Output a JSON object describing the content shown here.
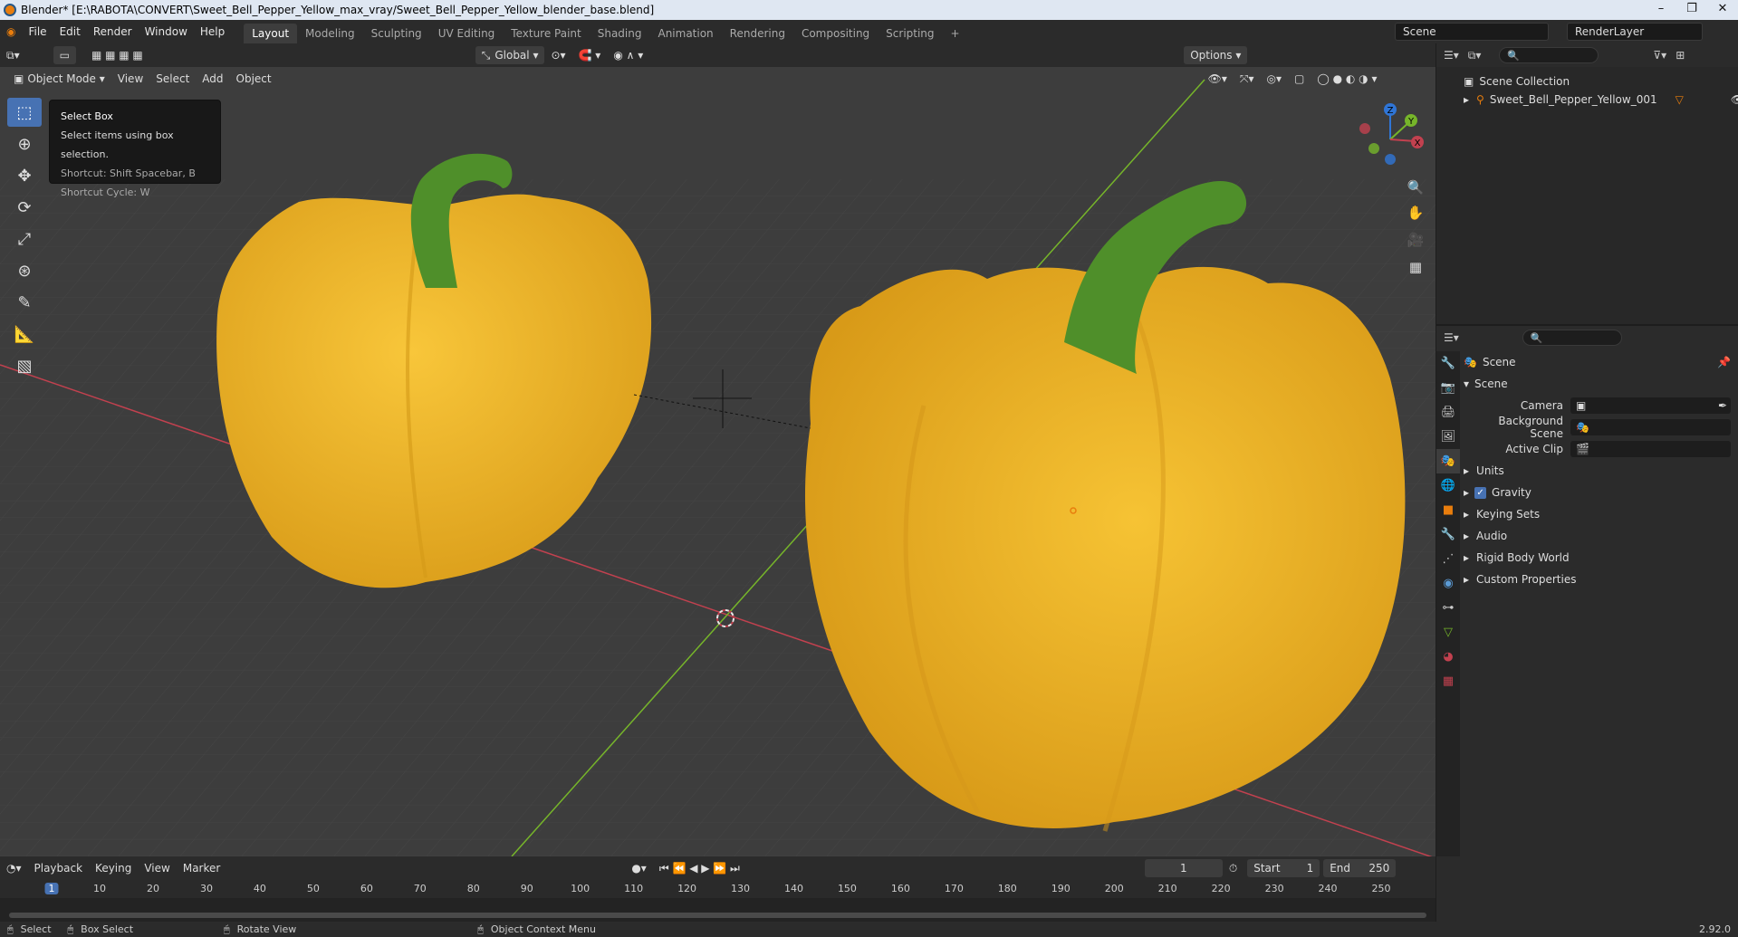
{
  "window": {
    "title": "Blender* [E:\\RABOTA\\CONVERT\\Sweet_Bell_Pepper_Yellow_max_vray/Sweet_Bell_Pepper_Yellow_blender_base.blend]",
    "controls": [
      "–",
      "❐",
      "✕"
    ]
  },
  "menu": [
    "File",
    "Edit",
    "Render",
    "Window",
    "Help"
  ],
  "workspaces": [
    {
      "label": "Layout",
      "active": true
    },
    {
      "label": "Modeling"
    },
    {
      "label": "Sculpting"
    },
    {
      "label": "UV Editing"
    },
    {
      "label": "Texture Paint"
    },
    {
      "label": "Shading"
    },
    {
      "label": "Animation"
    },
    {
      "label": "Rendering"
    },
    {
      "label": "Compositing"
    },
    {
      "label": "Scripting"
    }
  ],
  "add_workspace": "+",
  "scene": {
    "name": "Scene",
    "render_layer": "RenderLayer"
  },
  "viewport": {
    "mode": "Object Mode",
    "menus": [
      "View",
      "Select",
      "Add",
      "Object"
    ],
    "orientation": "Global",
    "options_label": "Options",
    "tooltip": {
      "title": "Select Box",
      "desc": "Select items using box selection.",
      "shortcut": "Shortcut: Shift Spacebar, B",
      "cycle": "Shortcut Cycle: W"
    },
    "gizmo": {
      "z": "Z",
      "y": "Y",
      "x": "X"
    },
    "colors": {
      "bg": "#3d3d3d",
      "pepper": "#f0b628",
      "stem": "#4f8f2a",
      "x_axis": "#c2414f",
      "y_axis": "#76b52a"
    }
  },
  "outliner": {
    "search_placeholder": "",
    "root": "Scene Collection",
    "items": [
      {
        "name": "Sweet_Bell_Pepper_Yellow_001"
      }
    ]
  },
  "properties": {
    "context": "Scene",
    "panel": "Scene",
    "fields": [
      {
        "label": "Camera"
      },
      {
        "label": "Background Scene"
      },
      {
        "label": "Active Clip"
      }
    ],
    "sections": [
      "Units",
      "Gravity",
      "Keying Sets",
      "Audio",
      "Rigid Body World",
      "Custom Properties"
    ],
    "gravity_checked": true
  },
  "timeline": {
    "menus": [
      "Playback",
      "Keying",
      "View",
      "Marker"
    ],
    "current_frame": "1",
    "start_label": "Start",
    "start": "1",
    "end_label": "End",
    "end": "250",
    "ticks": [
      "1",
      "10",
      "20",
      "30",
      "40",
      "50",
      "60",
      "70",
      "80",
      "90",
      "100",
      "110",
      "120",
      "130",
      "140",
      "150",
      "160",
      "170",
      "180",
      "190",
      "200",
      "210",
      "220",
      "230",
      "240",
      "250"
    ]
  },
  "status": {
    "select": "Select",
    "box_select": "Box Select",
    "rotate": "Rotate View",
    "context_menu": "Object Context Menu",
    "version": "2.92.0"
  }
}
